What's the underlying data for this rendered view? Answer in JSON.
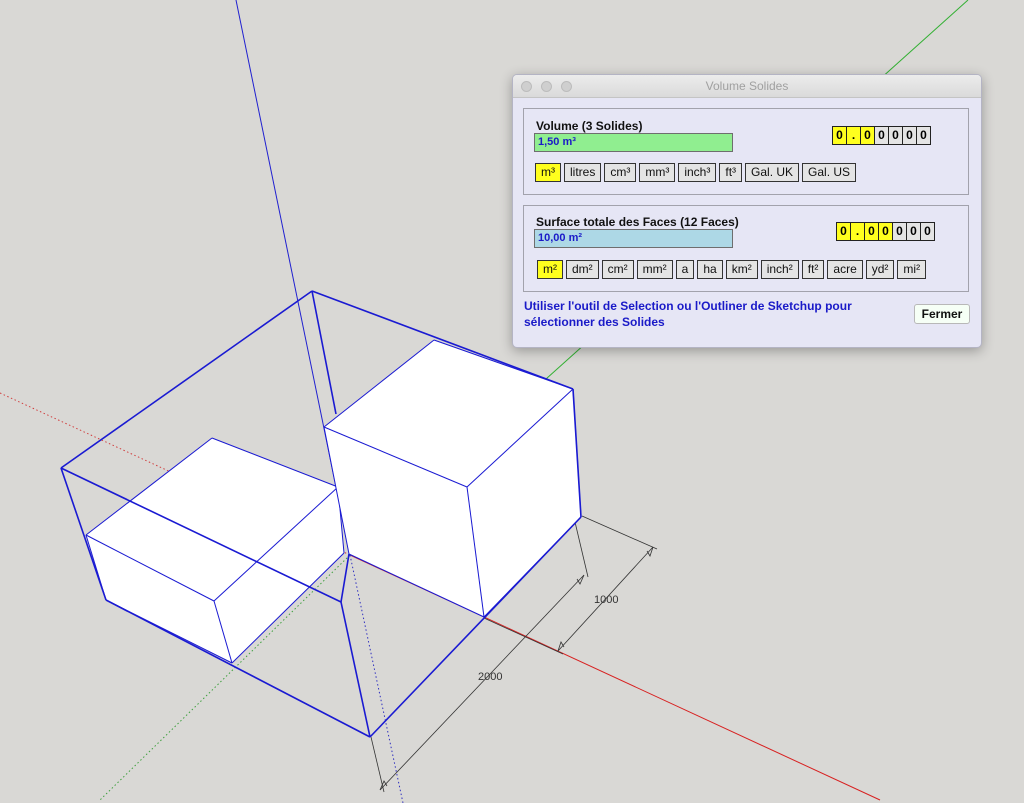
{
  "scene": {
    "dimension_1000": "1000",
    "dimension_2000": "2000"
  },
  "dialog": {
    "title": "Volume Solides",
    "volume": {
      "label": "Volume (3 Solides)",
      "value": "1,50 m³",
      "precision_digits": [
        "0",
        ".",
        "0",
        "0",
        "0",
        "0",
        "0"
      ],
      "highlighted_digits": [
        0,
        1,
        2
      ],
      "units": [
        "m³",
        "litres",
        "cm³",
        "mm³",
        "inch³",
        "ft³",
        "Gal. UK",
        "Gal. US"
      ],
      "selected_unit": "m³",
      "field_color": "#90ee90"
    },
    "surface": {
      "label": "Surface totale des Faces (12 Faces)",
      "value": "10,00 m²",
      "precision_digits": [
        "0",
        ".",
        "0",
        "0",
        "0",
        "0",
        "0"
      ],
      "highlighted_digits": [
        0,
        1,
        2,
        3
      ],
      "units": [
        "m²",
        "dm²",
        "cm²",
        "mm²",
        "a",
        "ha",
        "km²",
        "inch²",
        "ft²",
        "acre",
        "yd²",
        "mi²"
      ],
      "selected_unit": "m²",
      "field_color": "#add8e6"
    },
    "hint": "Utiliser l'outil de Selection ou l'Outliner de Sketchup pour sélectionner des Solides",
    "close_label": "Fermer"
  }
}
